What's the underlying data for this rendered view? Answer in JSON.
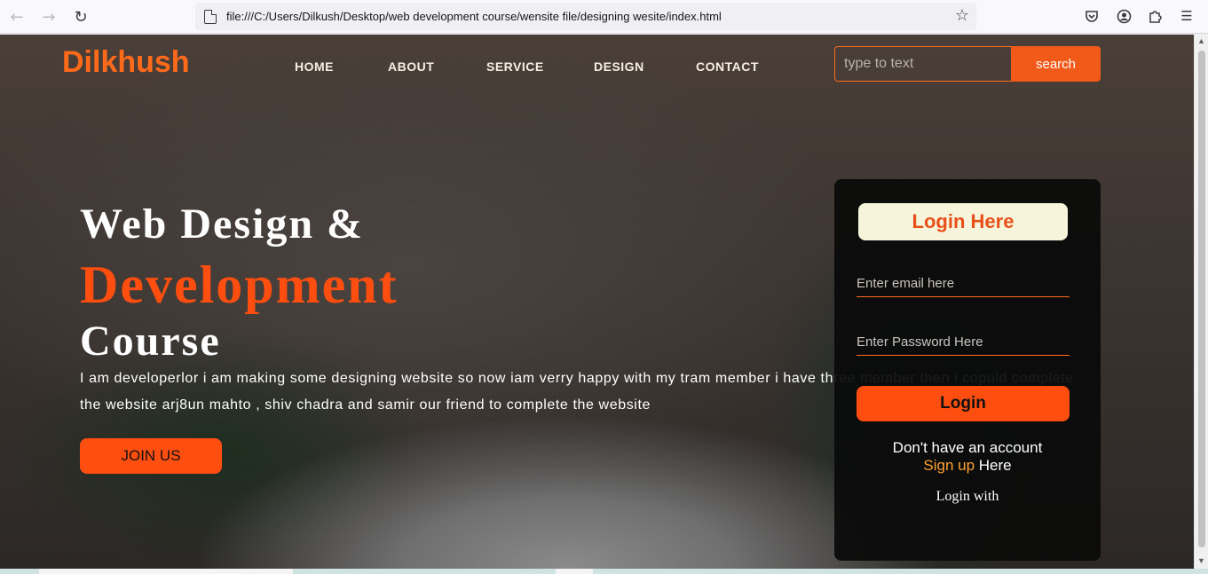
{
  "browser": {
    "url": "file:///C:/Users/Dilkush/Desktop/web development course/wensite file/designing wesite/index.html",
    "icons": [
      "back-arrow-icon",
      "forward-arrow-icon",
      "reload-icon",
      "page-icon",
      "bookmark-star-icon",
      "pocket-icon",
      "account-icon",
      "extensions-icon",
      "menu-icon"
    ]
  },
  "header": {
    "logo": "Dilkhush",
    "nav": [
      "HOME",
      "ABOUT",
      "SERVICE",
      "DESIGN",
      "CONTACT"
    ],
    "search_placeholder": "type to text",
    "search_label": "search"
  },
  "hero": {
    "line1": "Web Design &",
    "line2": "Development",
    "line3": "Course",
    "description": "I am developerlor i am making some designing website so now iam verry happy with my tram member i have three member then i copuld complete the website arj8un mahto , shiv chadra and samir our friend to complete the website",
    "join_label": "JOIN US"
  },
  "login": {
    "title": "Login Here",
    "email_placeholder": "Enter email here",
    "password_placeholder": "Enter Password Here",
    "button_label": "Login",
    "no_account": "Don't have an account",
    "signup_link": "Sign up",
    "signup_suffix": " Here",
    "login_with": "Login with"
  },
  "colors": {
    "accent": "#ff4e0f",
    "logo": "#ff6a1a",
    "signup": "#ffa033",
    "login_title_bg": "#f7f4dc"
  }
}
